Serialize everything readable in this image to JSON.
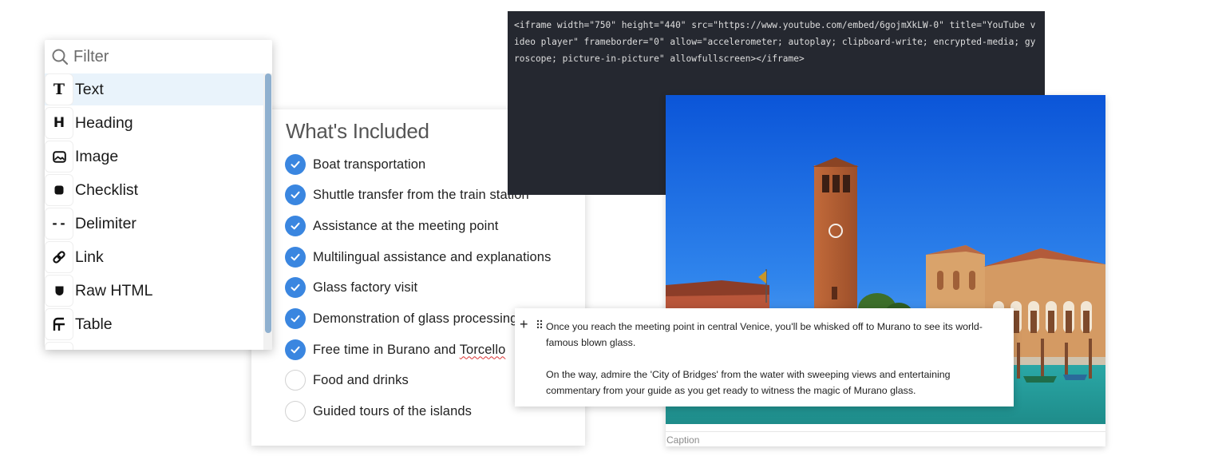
{
  "block_menu": {
    "filter_placeholder": "Filter",
    "items": [
      {
        "label": "Text",
        "icon": "text-type-icon"
      },
      {
        "label": "Heading",
        "icon": "heading-icon"
      },
      {
        "label": "Image",
        "icon": "image-icon"
      },
      {
        "label": "Checklist",
        "icon": "checklist-icon"
      },
      {
        "label": "Delimiter",
        "icon": "delimiter-icon"
      },
      {
        "label": "Link",
        "icon": "link-icon"
      },
      {
        "label": "Raw HTML",
        "icon": "raw-html-icon"
      },
      {
        "label": "Table",
        "icon": "table-icon"
      }
    ],
    "active_item": "Text"
  },
  "checklist": {
    "title": "What's Included",
    "items": [
      {
        "text": "Boat transportation",
        "checked": true
      },
      {
        "text": "Shuttle transfer from the train station",
        "checked": true
      },
      {
        "text": "Assistance at the meeting point",
        "checked": true
      },
      {
        "text": "Multilingual assistance and explanations",
        "checked": true
      },
      {
        "text": "Glass factory visit",
        "checked": true
      },
      {
        "text": "Demonstration of glass processing",
        "checked": true
      },
      {
        "text_prefix": "Free time in Burano and ",
        "text_flagged": "Torcello",
        "checked": true
      },
      {
        "text": "Food and drinks",
        "checked": false
      },
      {
        "text": "Guided tours of the islands",
        "checked": false
      }
    ]
  },
  "code_block": {
    "code": "<iframe width=\"750\" height=\"440\" src=\"https://www.youtube.com/embed/6gojmXkLW-0\" title=\"YouTube video player\" frameborder=\"0\" allow=\"accelerometer; autoplay; clipboard-write; encrypted-media; gyroscope; picture-in-picture\" allowfullscreen></iframe>"
  },
  "image_block": {
    "caption_placeholder": "Caption"
  },
  "paragraph": {
    "paragraph_1": "Once you reach the meeting point in central Venice, you'll be whisked off to Murano to see its world-famous blown glass.",
    "paragraph_2": "On the way, admire the 'City of Bridges' from the water with sweeping views and entertaining commentary from your guide as you get ready to witness the magic of Murano glass."
  },
  "colors": {
    "accent_blue": "#3a86e0",
    "code_background": "#252830",
    "menu_active_background": "#e9f3fb",
    "spellcheck_red": "#dd3333"
  }
}
